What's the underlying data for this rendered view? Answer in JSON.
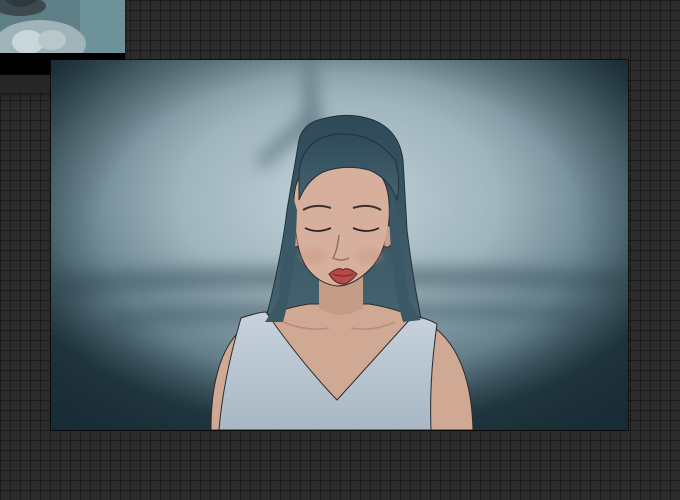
{
  "app": {
    "view": "drawing-canvas",
    "canvas_background": "#7e98a2",
    "workspace_color": "#2b2b2b"
  },
  "thumbnail": {
    "kind": "reference-image",
    "selected": true
  },
  "artwork": {
    "subject": "girl-with-closed-eyes",
    "palette": {
      "hair": "#3d5a68",
      "skin": "#d2ab98",
      "dress": "#b9c6d2",
      "lips": "#b7494b",
      "vignette": "#2c4652"
    }
  }
}
